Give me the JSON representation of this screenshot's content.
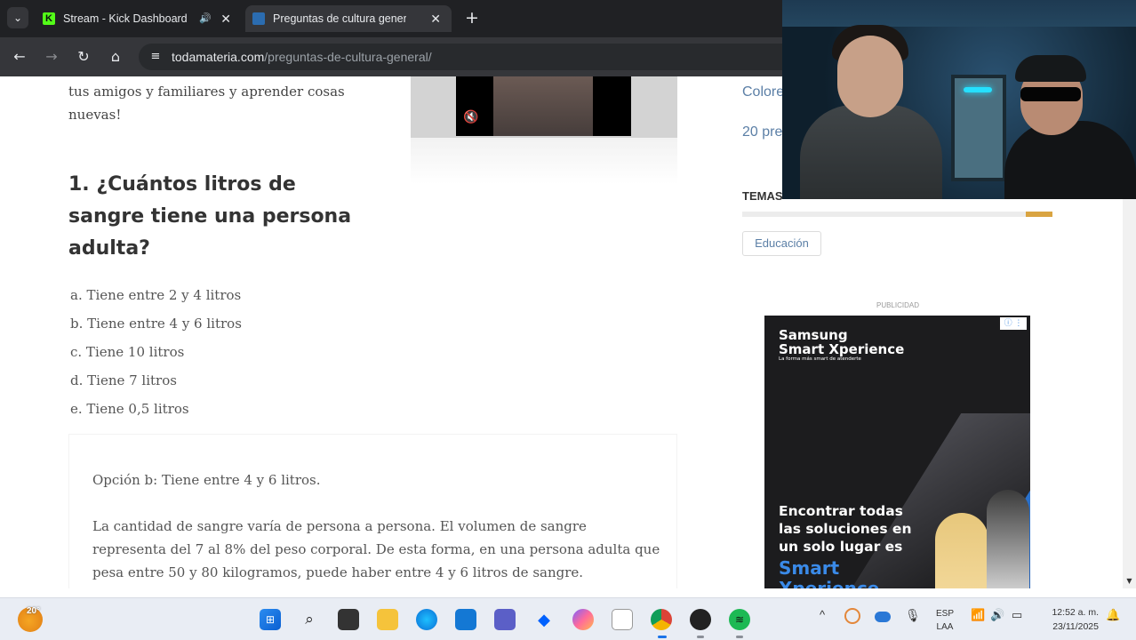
{
  "browser": {
    "tabs": [
      {
        "title": "Stream - Kick Dashboard",
        "favicon": "kick-logo-icon",
        "audio": "🔊",
        "close": "✕"
      },
      {
        "title": "Preguntas de cultura general (c",
        "favicon": "todamateria-icon",
        "close": "✕"
      }
    ],
    "tab_menu": "⌄",
    "new_tab": "+",
    "nav": {
      "back": "←",
      "forward": "→",
      "reload": "↻",
      "home": "⌂"
    },
    "site_info_icon": "≡",
    "url_domain": "todamateria.com",
    "url_path": "/preguntas-de-cultura-general/"
  },
  "article": {
    "intro": "tus amigos y familiares y aprender cosas nuevas!",
    "video_mute": "🔇",
    "question": "1. ¿Cuántos litros de sangre tiene una persona adulta?",
    "options": [
      "a. Tiene entre 2 y 4 litros",
      "b. Tiene entre 4 y 6 litros",
      "c. Tiene 10 litros",
      "d. Tiene 7 litros",
      "e. Tiene 0,5 litros"
    ],
    "answer_title": "Opción b: Tiene entre 4 y 6 litros.",
    "answer_text": "La cantidad de sangre varía de persona a persona. El volumen de sangre representa del 7 al 8% del peso corporal. De esta forma, en una persona adulta que pesa entre 50 y 80 kilogramos, puede haber entre 4 y 6 litros de sangre."
  },
  "sidebar": {
    "link1": "Colore",
    "link2": "20 pre",
    "temas": "TEMAS",
    "tag": "Educación",
    "ad_label": "PUBLICIDAD",
    "ad": {
      "brand_line1": "Samsung",
      "brand_line2": "Smart Xperience",
      "tagline": "La forma más smart de atenderte",
      "headline": "Encontrar todas las soluciones en un solo lugar es",
      "accent1": "Smart",
      "accent2": "Xperience",
      "adchoices": "ⓘ ⋮"
    }
  },
  "taskbar": {
    "weather_temp": "20°",
    "lang_line1": "ESP",
    "lang_line2": "LAA",
    "time": "12:52 a. m.",
    "date": "23/11/2025",
    "tray_chevron": "^"
  },
  "colors": {
    "chrome_dark": "#202124",
    "accent_kick": "#53fc18",
    "link_blue": "#5b7fa6"
  }
}
